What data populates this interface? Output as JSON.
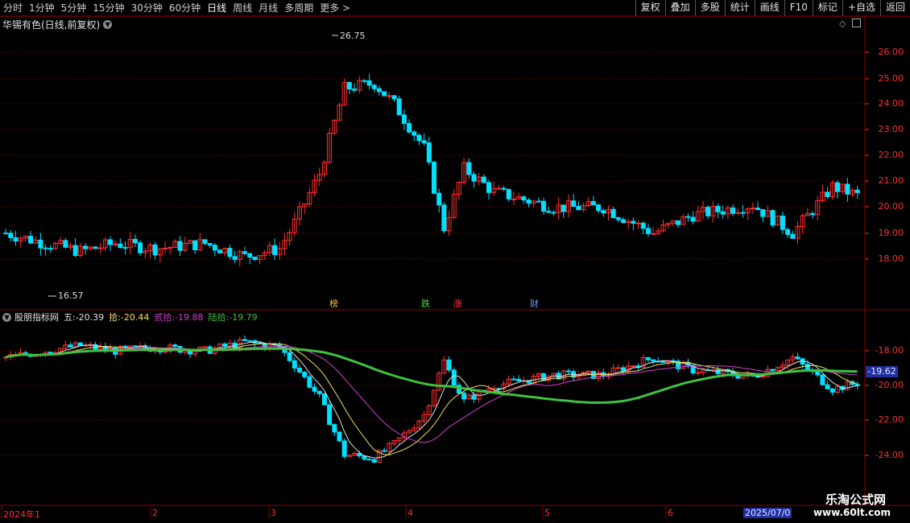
{
  "toolbar": {
    "periods": [
      "分时",
      "1分钟",
      "5分钟",
      "15分钟",
      "30分钟",
      "60分钟",
      "日线",
      "周线",
      "月线",
      "多周期",
      "更多 >"
    ],
    "active_period": "日线",
    "actions": [
      "复权",
      "叠加",
      "多股",
      "统计",
      "画线",
      "F10",
      "标记",
      "+自选",
      "返回"
    ]
  },
  "main": {
    "title": "华锡有色(日线,前复权)",
    "high_label": "26.75",
    "low_label": "16.57",
    "y_labels": [
      "26.00",
      "25.00",
      "24.00",
      "23.00",
      "22.00",
      "21.00",
      "20.00",
      "19.00",
      "18.00"
    ],
    "tags": [
      {
        "text": "榜",
        "color": "#f0c040"
      },
      {
        "text": "跌",
        "color": "#40e040"
      },
      {
        "text": "涨",
        "color": "#ff4040"
      },
      {
        "text": "财",
        "color": "#60a0ff"
      }
    ]
  },
  "indicator": {
    "name": "股朋指标网",
    "items": [
      {
        "label": "五:-20.39",
        "color": "#e0e0e0"
      },
      {
        "label": "拾:-20.44",
        "color": "#f0e060"
      },
      {
        "label": "贰拾:-19.88",
        "color": "#d040d0"
      },
      {
        "label": "陆拾:-19.79",
        "color": "#40c040"
      }
    ],
    "y_labels": [
      "-18.00",
      "-20.00",
      "-22.00",
      "-24.00"
    ],
    "current_value": "-19.62"
  },
  "xaxis": {
    "labels": [
      "2024年1",
      "2",
      "3",
      "4",
      "5",
      "6"
    ],
    "highlight": "2025/07/0"
  },
  "watermark": {
    "line1": "乐淘公式网",
    "line2": "www.60lt.com"
  },
  "colors": {
    "up": "#ff3030",
    "down": "#00e0ff",
    "border": "#8b0000"
  }
}
